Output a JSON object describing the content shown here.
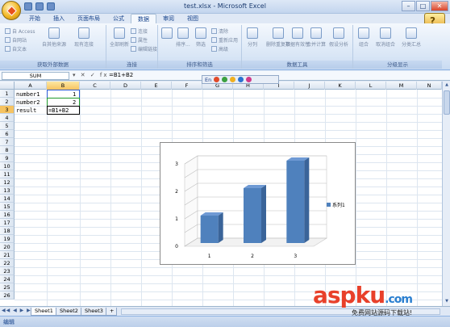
{
  "window": {
    "title": "test.xlsx - Microsoft Excel"
  },
  "ribbon_tabs": [
    "开始",
    "插入",
    "页面布局",
    "公式",
    "数据",
    "审阅",
    "视图"
  ],
  "active_tab": "数据",
  "ribbon": {
    "groups": [
      {
        "label": "获取外部数据",
        "items": [
          "自 Access",
          "自网站",
          "自文本",
          "自其他来源",
          "现有连接"
        ]
      },
      {
        "label": "连接",
        "items": [
          "全部刷新",
          "连接",
          "属性",
          "编辑链接"
        ]
      },
      {
        "label": "排序和筛选",
        "items": [
          "排序...",
          "筛选",
          "清除",
          "重新应用",
          "高级"
        ]
      },
      {
        "label": "数据工具",
        "items": [
          "分列",
          "删除重复项",
          "数据有效性",
          "合并计算",
          "假设分析"
        ]
      },
      {
        "label": "分级显示",
        "items": [
          "组合",
          "取消组合",
          "分类汇总"
        ]
      }
    ]
  },
  "formula_bar": {
    "name_box": "SUM",
    "icons": "▾ ✕ ✓ fx",
    "formula": "=B1+B2"
  },
  "ime_bar": {
    "label": "En"
  },
  "columns": [
    "A",
    "B",
    "C",
    "D",
    "E",
    "F",
    "G",
    "H",
    "I",
    "J",
    "K",
    "L",
    "M",
    "N"
  ],
  "rows": [
    "1",
    "2",
    "3",
    "4",
    "5",
    "6",
    "7",
    "8",
    "9",
    "10",
    "11",
    "12",
    "13",
    "14",
    "15",
    "16",
    "17",
    "18",
    "19",
    "20",
    "21",
    "22",
    "23",
    "24",
    "25",
    "26"
  ],
  "cells": {
    "a1": "number1",
    "b1": "1",
    "a2": "number2",
    "b2": "2",
    "a3": "result",
    "b3": "=B1+B2"
  },
  "sheets": [
    "Sheet1",
    "Sheet2",
    "Sheet3"
  ],
  "active_sheet": "Sheet1",
  "status": {
    "mode": "编辑"
  },
  "watermark": {
    "brand": "aspku",
    "suffix": ".com",
    "tagline": "免费网站源码下载站!"
  },
  "chart_data": {
    "type": "bar",
    "style": "3d-column",
    "categories": [
      "1",
      "2",
      "3"
    ],
    "series": [
      {
        "name": "系列1",
        "values": [
          1,
          2,
          3
        ],
        "color": "#4f81bd"
      }
    ],
    "ylim": [
      0,
      3
    ],
    "yticks": [
      "0",
      "0.5",
      "1",
      "1.5",
      "2",
      "2.5",
      "3"
    ],
    "grid": true,
    "legend": "right"
  }
}
